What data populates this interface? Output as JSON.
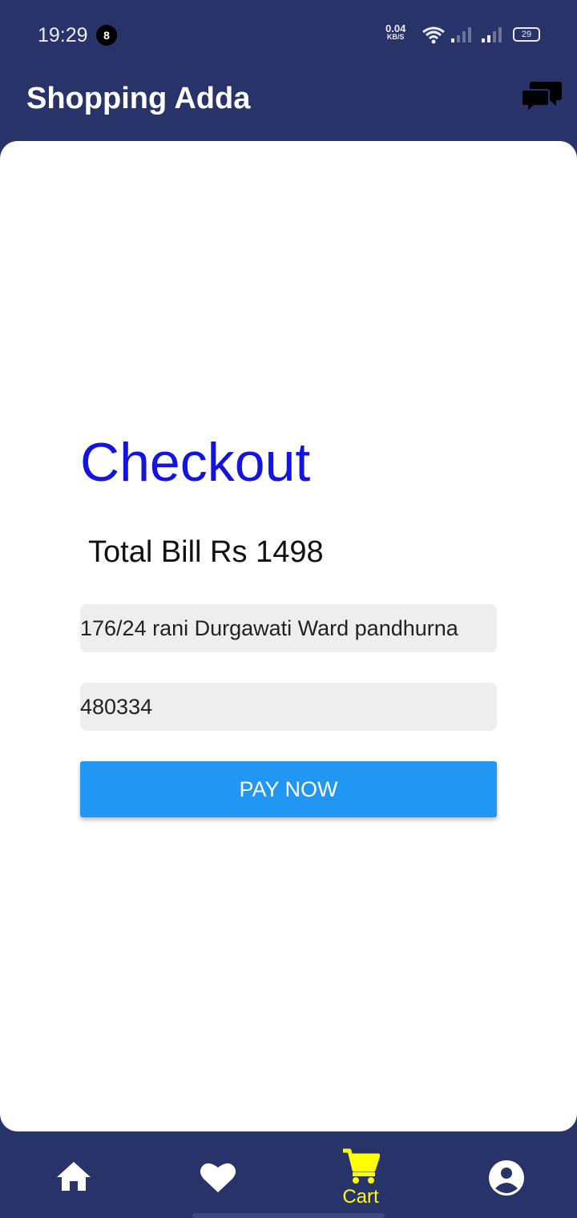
{
  "status_bar": {
    "time": "19:29",
    "notification_count": "8",
    "net_speed_value": "0.04",
    "net_speed_unit": "KB/S",
    "battery": "29"
  },
  "app_bar": {
    "title": "Shopping Adda",
    "chat_icon": "chat-bubbles-icon"
  },
  "checkout": {
    "title": "Checkout",
    "total_bill": "Total Bill Rs 1498",
    "address_value": "176/24 rani Durgawati Ward pandhurna",
    "pincode_value": "480334",
    "pay_button_label": "PAY NOW"
  },
  "bottom_nav": {
    "items": [
      {
        "icon": "home-icon",
        "label": ""
      },
      {
        "icon": "heart-icon",
        "label": ""
      },
      {
        "icon": "cart-icon",
        "label": "Cart"
      },
      {
        "icon": "account-icon",
        "label": ""
      }
    ],
    "active_color": "#ffff00"
  },
  "colors": {
    "primary": "#283469",
    "accent_title": "#1414e0",
    "button": "#2196f3"
  }
}
